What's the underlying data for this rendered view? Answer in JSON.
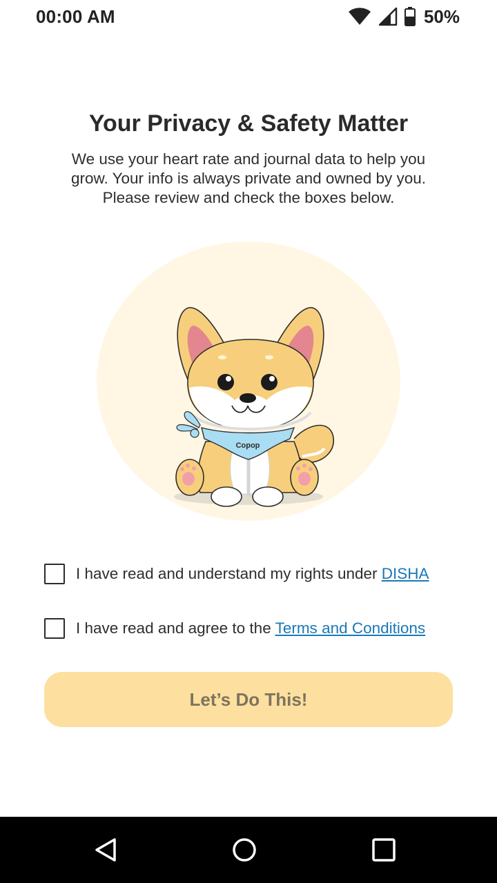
{
  "status_bar": {
    "time": "00:00 AM",
    "battery_percent": "50%",
    "icons": [
      "wifi-icon",
      "cell-signal-icon",
      "battery-icon"
    ]
  },
  "header": {
    "title": "Your Privacy & Safety Matter",
    "subtitle": "We use your heart rate and journal data to help you grow. Your info is always private and owned by you. Please review and check the boxes below."
  },
  "illustration": {
    "bandana_text": "Copop"
  },
  "consents": [
    {
      "text": "I have read and understand my rights under ",
      "link": "DISHA",
      "checked": false
    },
    {
      "text": "I have read and agree to the ",
      "link": "Terms and Conditions",
      "checked": false
    }
  ],
  "cta": {
    "label": "Let’s Do This!"
  },
  "nav_bar": {
    "buttons": [
      "back-icon",
      "home-icon",
      "recents-icon"
    ]
  },
  "colors": {
    "accent": "#fde09f",
    "hero_bg": "#fff7e4",
    "link": "#1a78b5",
    "cta_text": "#7d735f"
  }
}
